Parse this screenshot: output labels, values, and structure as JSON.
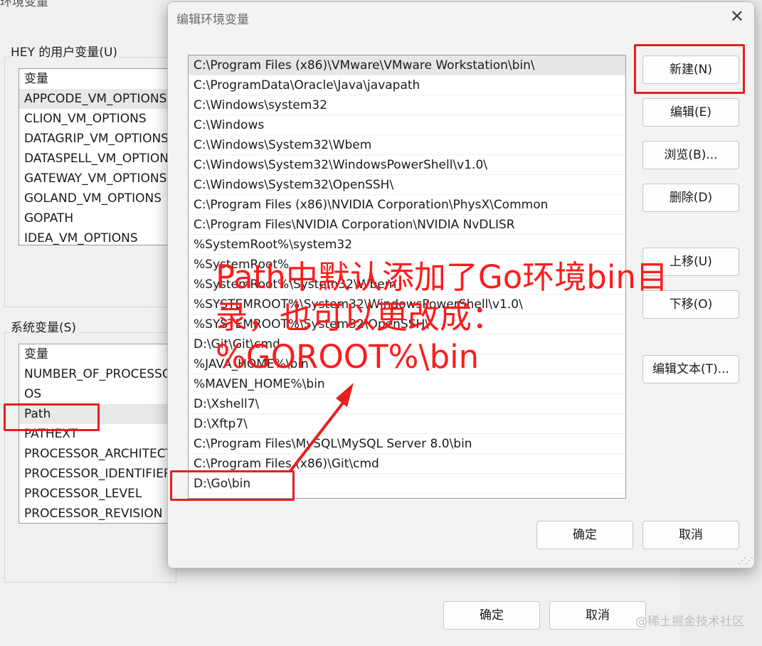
{
  "background_window": {
    "title": "环境变量",
    "user_group_label": "HEY 的用户变量(U)",
    "user_vars_header": "变量",
    "user_vars": [
      "APPCODE_VM_OPTIONS",
      "CLION_VM_OPTIONS",
      "DATAGRIP_VM_OPTIONS",
      "DATASPELL_VM_OPTIONS",
      "GATEWAY_VM_OPTIONS",
      "GOLAND_VM_OPTIONS",
      "GOPATH",
      "IDEA_VM_OPTIONS"
    ],
    "system_group_label": "系统变量(S)",
    "system_vars_header": "变量",
    "system_vars": [
      "NUMBER_OF_PROCESSORS",
      "OS",
      "Path",
      "PATHEXT",
      "PROCESSOR_ARCHITECTURE",
      "PROCESSOR_IDENTIFIER",
      "PROCESSOR_LEVEL",
      "PROCESSOR_REVISION"
    ],
    "ok_label": "确定",
    "cancel_label": "取消"
  },
  "dialog": {
    "title": "编辑环境变量",
    "close_glyph": "✕",
    "paths": [
      "C:\\Program Files (x86)\\VMware\\VMware Workstation\\bin\\",
      "C:\\ProgramData\\Oracle\\Java\\javapath",
      "C:\\Windows\\system32",
      "C:\\Windows",
      "C:\\Windows\\System32\\Wbem",
      "C:\\Windows\\System32\\WindowsPowerShell\\v1.0\\",
      "C:\\Windows\\System32\\OpenSSH\\",
      "C:\\Program Files (x86)\\NVIDIA Corporation\\PhysX\\Common",
      "C:\\Program Files\\NVIDIA Corporation\\NVIDIA NvDLISR",
      "%SystemRoot%\\system32",
      "%SystemRoot%",
      "%SystemRoot%\\System32\\Wbem",
      "%SYSTEMROOT%\\System32\\WindowsPowerShell\\v1.0\\",
      "%SYSTEMROOT%\\System32\\OpenSSH\\",
      "D:\\Git\\Git\\cmd",
      "%JAVA_HOME%\\bin",
      "%MAVEN_HOME%\\bin",
      "D:\\Xshell7\\",
      "D:\\Xftp7\\",
      "C:\\Program Files\\MySQL\\MySQL Server 8.0\\bin",
      "C:\\Program Files (x86)\\Git\\cmd",
      "D:\\Go\\bin"
    ],
    "buttons": {
      "new": "新建(N)",
      "edit": "编辑(E)",
      "browse": "浏览(B)...",
      "delete": "删除(D)",
      "move_up": "上移(U)",
      "move_down": "下移(O)",
      "edit_text": "编辑文本(T)...",
      "ok": "确定",
      "cancel": "取消"
    }
  },
  "annotation": {
    "line1": "Path中默认添加了Go环境bin目",
    "line2": "录，也可以更改成：",
    "line3": "%GOROOT%\\bin"
  },
  "watermark": "@稀土掘金技术社区",
  "colors": {
    "annotation_red": "#e5201f"
  }
}
